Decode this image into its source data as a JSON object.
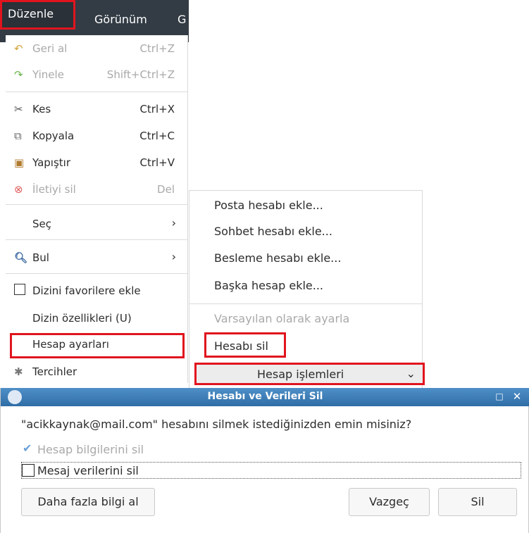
{
  "menubar": {
    "duzenle": "Düzenle",
    "gorunum": "Görünüm",
    "partial": "G"
  },
  "edit_menu": {
    "undo": {
      "label": "Geri al",
      "shortcut": "Ctrl+Z"
    },
    "redo": {
      "label": "Yinele",
      "shortcut": "Shift+Ctrl+Z"
    },
    "cut": {
      "label": "Kes",
      "shortcut": "Ctrl+X"
    },
    "copy": {
      "label": "Kopyala",
      "shortcut": "Ctrl+C"
    },
    "paste": {
      "label": "Yapıştır",
      "shortcut": "Ctrl+V"
    },
    "delete_msg": {
      "label": "İletiyi sil",
      "shortcut": "Del"
    },
    "select": "Seç",
    "find": "Bul",
    "add_favorite": "Dizini favorilere ekle",
    "folder_props": "Dizin özellikleri (U)",
    "account_settings": "Hesap ayarları",
    "preferences": "Tercihler"
  },
  "account_menu": {
    "add_mail": "Posta hesabı ekle...",
    "add_chat": "Sohbet hesabı ekle...",
    "add_feed": "Besleme hesabı ekle...",
    "add_other": "Başka hesap ekle...",
    "set_default": "Varsayılan olarak ayarla",
    "delete_account": "Hesabı sil",
    "account_actions": "Hesap işlemleri"
  },
  "dialog": {
    "title": "Hesabı ve Verileri Sil",
    "message": "\"acikkaynak@mail.com\" hesabını silmek istediğinizden emin misiniz?",
    "remove_account_info": "Hesap bilgilerini sil",
    "remove_message_data": "Mesaj verilerini sil",
    "more_info": "Daha fazla bilgi al",
    "cancel": "Vazgeç",
    "delete": "Sil"
  }
}
